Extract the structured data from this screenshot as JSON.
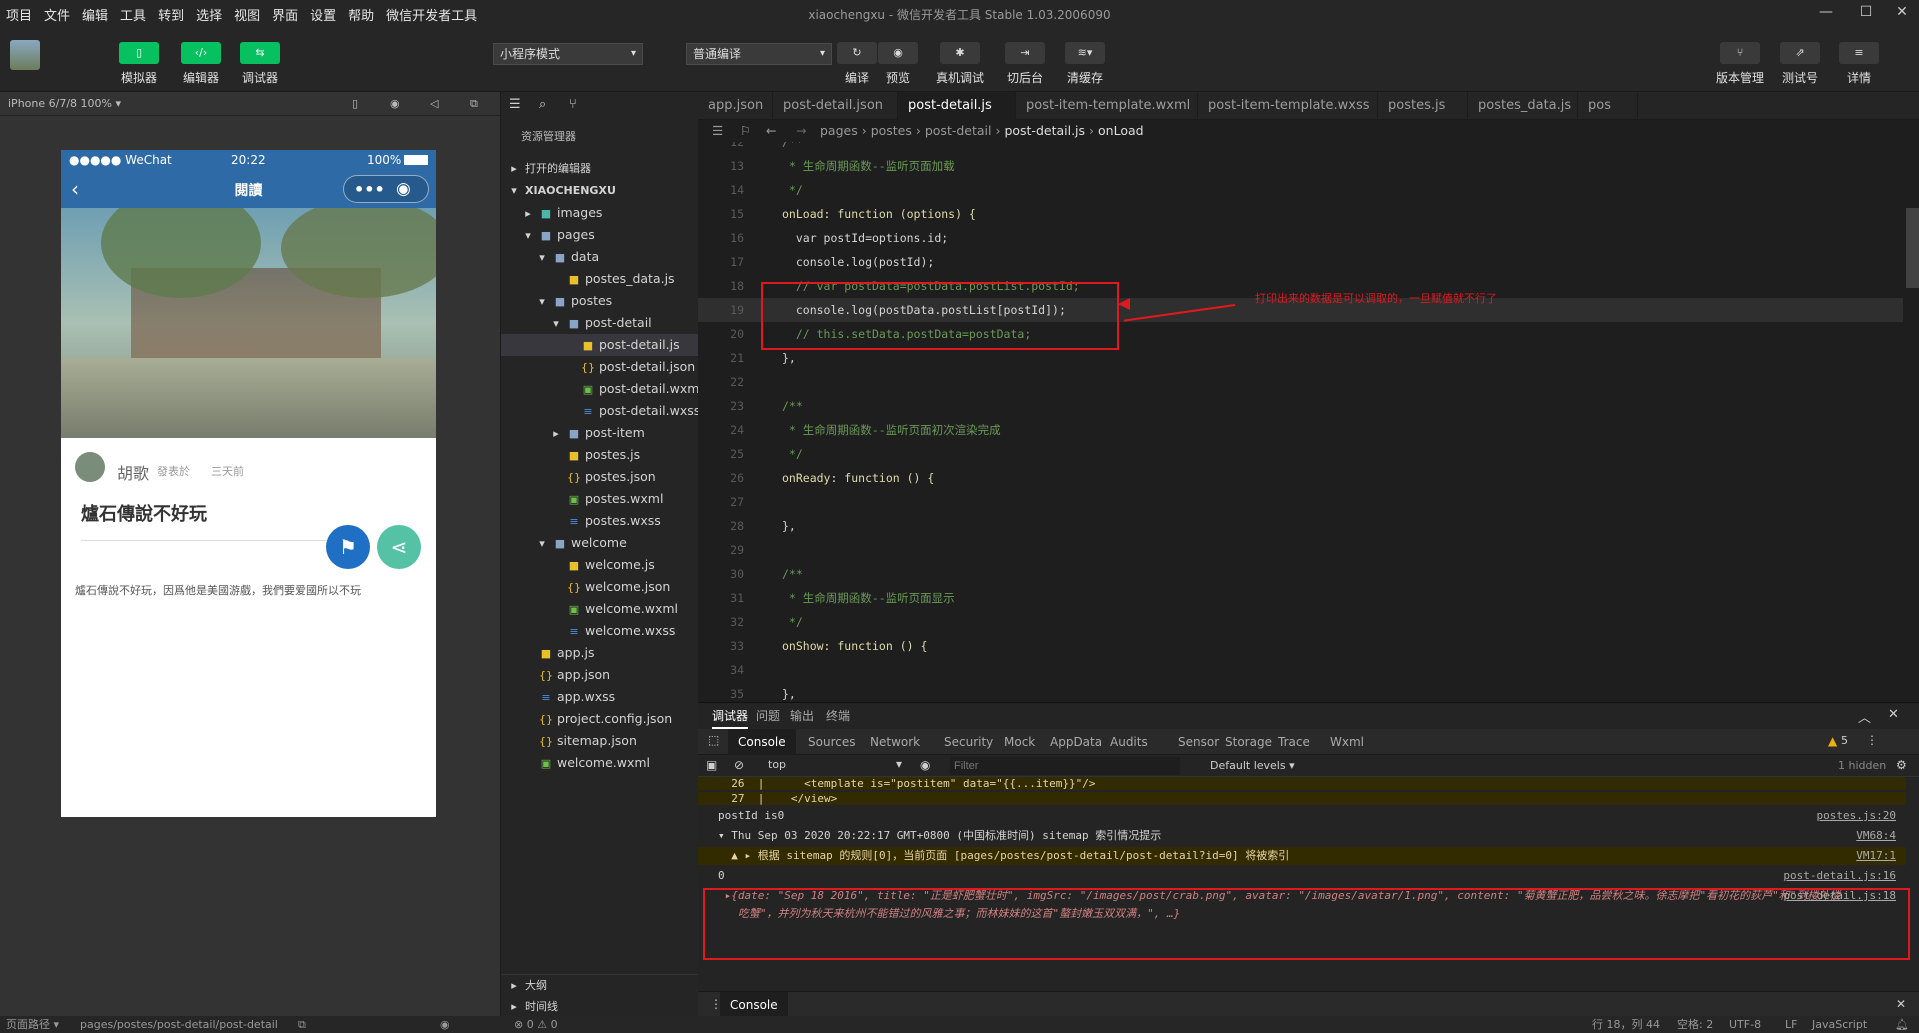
{
  "menu": [
    "项目",
    "文件",
    "编辑",
    "工具",
    "转到",
    "选择",
    "视图",
    "界面",
    "设置",
    "帮助",
    "微信开发者工具"
  ],
  "window_title": "xiaochengxu - 微信开发者工具 Stable 1.03.2006090",
  "toolbar": {
    "simulator": "模拟器",
    "editor": "编辑器",
    "debugger": "调试器",
    "mode": "小程序模式",
    "compile_mode": "普通编译",
    "compile": "编译",
    "preview": "预览",
    "real_debug": "真机调试",
    "background": "切后台",
    "clear_cache": "清缓存",
    "version": "版本管理",
    "test": "测试号",
    "details": "详情"
  },
  "simulator": {
    "device": "iPhone 6/7/8 100% ▾",
    "status": {
      "carrier": "●●●●● WeChat",
      "time": "20:22",
      "battery": "100%"
    },
    "nav_title": "閱讀",
    "author": "胡歌",
    "posted": "發表於",
    "time_ago": "三天前",
    "post_title": "爐石傳說不好玩",
    "post_content": "爐石傳說不好玩，因爲他是美國游戲，我們要爱國所以不玩"
  },
  "explorer": {
    "header": "资源管理器",
    "open_editors": "打开的编辑器",
    "project": "XIAOCHENGXU",
    "items": [
      {
        "label": "images",
        "indent": 1,
        "icon": "folder-img-icon",
        "arrow": "▸"
      },
      {
        "label": "pages",
        "indent": 1,
        "icon": "folder-icon",
        "arrow": "▾"
      },
      {
        "label": "data",
        "indent": 2,
        "icon": "folder-icon",
        "arrow": "▾"
      },
      {
        "label": "postes_data.js",
        "indent": 3,
        "icon": "js-file-icon",
        "arrow": ""
      },
      {
        "label": "postes",
        "indent": 2,
        "icon": "folder-icon",
        "arrow": "▾"
      },
      {
        "label": "post-detail",
        "indent": 3,
        "icon": "folder-icon",
        "arrow": "▾"
      },
      {
        "label": "post-detail.js",
        "indent": 4,
        "icon": "js-file-icon",
        "arrow": "",
        "selected": true
      },
      {
        "label": "post-detail.json",
        "indent": 4,
        "icon": "json-file-icon",
        "arrow": ""
      },
      {
        "label": "post-detail.wxml",
        "indent": 4,
        "icon": "wxml-file-icon",
        "arrow": ""
      },
      {
        "label": "post-detail.wxss",
        "indent": 4,
        "icon": "wxss-file-icon",
        "arrow": ""
      },
      {
        "label": "post-item",
        "indent": 3,
        "icon": "folder-icon",
        "arrow": "▸"
      },
      {
        "label": "postes.js",
        "indent": 3,
        "icon": "js-file-icon",
        "arrow": ""
      },
      {
        "label": "postes.json",
        "indent": 3,
        "icon": "json-file-icon",
        "arrow": ""
      },
      {
        "label": "postes.wxml",
        "indent": 3,
        "icon": "wxml-file-icon",
        "arrow": ""
      },
      {
        "label": "postes.wxss",
        "indent": 3,
        "icon": "wxss-file-icon",
        "arrow": ""
      },
      {
        "label": "welcome",
        "indent": 2,
        "icon": "folder-icon",
        "arrow": "▾"
      },
      {
        "label": "welcome.js",
        "indent": 3,
        "icon": "js-file-icon",
        "arrow": ""
      },
      {
        "label": "welcome.json",
        "indent": 3,
        "icon": "json-file-icon",
        "arrow": ""
      },
      {
        "label": "welcome.wxml",
        "indent": 3,
        "icon": "wxml-file-icon",
        "arrow": ""
      },
      {
        "label": "welcome.wxss",
        "indent": 3,
        "icon": "wxss-file-icon",
        "arrow": ""
      },
      {
        "label": "app.js",
        "indent": 1,
        "icon": "js-file-icon",
        "arrow": ""
      },
      {
        "label": "app.json",
        "indent": 1,
        "icon": "json-file-icon",
        "arrow": ""
      },
      {
        "label": "app.wxss",
        "indent": 1,
        "icon": "wxss-file-icon",
        "arrow": ""
      },
      {
        "label": "project.config.json",
        "indent": 1,
        "icon": "json-file-icon",
        "arrow": ""
      },
      {
        "label": "sitemap.json",
        "indent": 1,
        "icon": "json-file-icon",
        "arrow": ""
      },
      {
        "label": "welcome.wxml",
        "indent": 1,
        "icon": "wxml-file-icon",
        "arrow": ""
      }
    ],
    "outline": "大纲",
    "timeline": "时间线"
  },
  "tabs": [
    "app.json",
    "post-detail.json",
    "post-detail.js",
    "post-item-template.wxml",
    "post-item-template.wxss",
    "postes.js",
    "postes_data.js",
    "pos"
  ],
  "active_tab": "post-detail.js",
  "breadcrumb": [
    "pages",
    "postes",
    "post-detail",
    "post-detail.js",
    "onLoad"
  ],
  "code": [
    {
      "n": "12",
      "t": "/**",
      "c": "#6a9955"
    },
    {
      "n": "13",
      "t": " * 生命周期函数--监听页面加载",
      "c": "#6a9955"
    },
    {
      "n": "14",
      "t": " */",
      "c": "#6a9955"
    },
    {
      "n": "15",
      "t": "onLoad: function (options) {",
      "c": "#dcdcaa"
    },
    {
      "n": "16",
      "t": "  var postId=options.id;",
      "c": "#d4d4d4"
    },
    {
      "n": "17",
      "t": "  console.log(postId);",
      "c": "#d4d4d4"
    },
    {
      "n": "18",
      "t": "  // var postData=postData.postList.postId;",
      "c": "#6a9955"
    },
    {
      "n": "19",
      "t": "  console.log(postData.postList[postId]);",
      "c": "#d4d4d4"
    },
    {
      "n": "20",
      "t": "  // this.setData.postData=postData;",
      "c": "#6a9955"
    },
    {
      "n": "21",
      "t": "},",
      "c": "#d4d4d4"
    },
    {
      "n": "22",
      "t": "",
      "c": "#d4d4d4"
    },
    {
      "n": "23",
      "t": "/**",
      "c": "#6a9955"
    },
    {
      "n": "24",
      "t": " * 生命周期函数--监听页面初次渲染完成",
      "c": "#6a9955"
    },
    {
      "n": "25",
      "t": " */",
      "c": "#6a9955"
    },
    {
      "n": "26",
      "t": "onReady: function () {",
      "c": "#dcdcaa"
    },
    {
      "n": "27",
      "t": "",
      "c": "#d4d4d4"
    },
    {
      "n": "28",
      "t": "},",
      "c": "#d4d4d4"
    },
    {
      "n": "29",
      "t": "",
      "c": "#d4d4d4"
    },
    {
      "n": "30",
      "t": "/**",
      "c": "#6a9955"
    },
    {
      "n": "31",
      "t": " * 生命周期函数--监听页面显示",
      "c": "#6a9955"
    },
    {
      "n": "32",
      "t": " */",
      "c": "#6a9955"
    },
    {
      "n": "33",
      "t": "onShow: function () {",
      "c": "#dcdcaa"
    },
    {
      "n": "34",
      "t": "",
      "c": "#d4d4d4"
    },
    {
      "n": "35",
      "t": "},",
      "c": "#d4d4d4"
    }
  ],
  "annotation": "打印出来的数据是可以调取的，一旦赋值就不行了",
  "devtools": {
    "top_tabs": [
      "调试器",
      "问题",
      "输出",
      "终端"
    ],
    "console_tabs": [
      "Console",
      "Sources",
      "Network",
      "Security",
      "Mock",
      "AppData",
      "Audits",
      "Sensor",
      "Storage",
      "Trace",
      "Wxml"
    ],
    "warn_count": "5",
    "context": "top",
    "filter_placeholder": "Filter",
    "levels": "Default levels ▾",
    "hidden": "1 hidden",
    "lines": [
      {
        "t": "  26  |      <template is=\"postitem\" data=\"{{...item}}\"/>",
        "bg": "#332b00",
        "c": "#e8d5a0",
        "src": ""
      },
      {
        "t": "  27  |    </view>",
        "bg": "#332b00",
        "c": "#e8d5a0",
        "src": ""
      },
      {
        "t": "postId is0",
        "bg": "#242424",
        "c": "#d4d4d4",
        "src": "postes.js:20"
      },
      {
        "t": "▾ Thu Sep 03 2020 20:22:17 GMT+0800 (中国标准时间) sitemap 索引情况提示",
        "bg": "#242424",
        "c": "#d4d4d4",
        "src": "VM68:4"
      },
      {
        "t": "  ▲ ▸ 根据 sitemap 的规则[0]，当前页面 [pages/postes/post-detail/post-detail?id=0] 将被索引",
        "bg": "#332b00",
        "c": "#e8d5a0",
        "src": "VM17:1"
      },
      {
        "t": "0",
        "bg": "#242424",
        "c": "#d4d4d4",
        "src": "post-detail.js:16"
      },
      {
        "t": " ▸{date: \"Sep 18 2016\", title: \"正是虾肥蟹壮时\", imgSrc: \"/images/post/crab.png\", avatar: \"/images/avatar/1.png\", content: \"菊黄蟹正肥，品尝秋之味。徐志摩把\"看初花的荻芦\"和\"到楼外楼",
        "bg": "#242424",
        "c": "#d4d4d4",
        "src": "post-detail.js:18"
      },
      {
        "t": "   吃蟹\"，并列为秋天来杭州不能错过的风雅之事；而林妹妹的这首\"螯封嫩玉双双满，\", …}",
        "bg": "#242424",
        "c": "#d4d4d4",
        "src": ""
      }
    ],
    "bottom_tab": "Console"
  },
  "statusbar": {
    "page_path_label": "页面路径 ▾",
    "page_path": "pages/postes/post-detail/post-detail",
    "errors": "⊗ 0 ⚠ 0",
    "position": "行 18，列 44",
    "spaces": "空格: 2",
    "encoding": "UTF-8",
    "eol": "LF",
    "language": "JavaScript"
  },
  "colors": {
    "accent": "#07c160",
    "nav": "#2d6aa6",
    "annotation": "#e0191f"
  }
}
